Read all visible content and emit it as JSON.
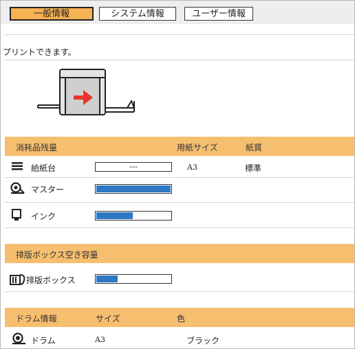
{
  "tabs": [
    {
      "label": "一般情報",
      "active": true
    },
    {
      "label": "システム情報",
      "active": false
    },
    {
      "label": "ユーザー情報",
      "active": false
    }
  ],
  "status_message": "プリントできます。",
  "consumables": {
    "header": {
      "name": "消耗品残量",
      "paper_size": "用紙サイズ",
      "paper_type": "紙質"
    },
    "rows": [
      {
        "icon": "paper-feed-icon",
        "label": "給紙台",
        "gauge_text": "---",
        "level": null,
        "paper_size": "A3",
        "paper_type": "標準"
      },
      {
        "icon": "master-roll-icon",
        "label": "マスター",
        "level": 1.0
      },
      {
        "icon": "ink-cartridge-icon",
        "label": "インク",
        "level": 0.5
      }
    ]
  },
  "disposal": {
    "header": "排版ボックス空き容量",
    "row": {
      "icon": "disposal-box-icon",
      "label": "排版ボックス",
      "level": 0.3
    }
  },
  "drum": {
    "header": {
      "name": "ドラム情報",
      "size": "サイズ",
      "color": "色"
    },
    "row": {
      "icon": "drum-icon",
      "label": "ドラム",
      "size": "A3",
      "color": "ブラック"
    }
  },
  "colors": {
    "accent": "#f6be6f",
    "gauge": "#2f78c4",
    "arrow": "#e8342b"
  }
}
